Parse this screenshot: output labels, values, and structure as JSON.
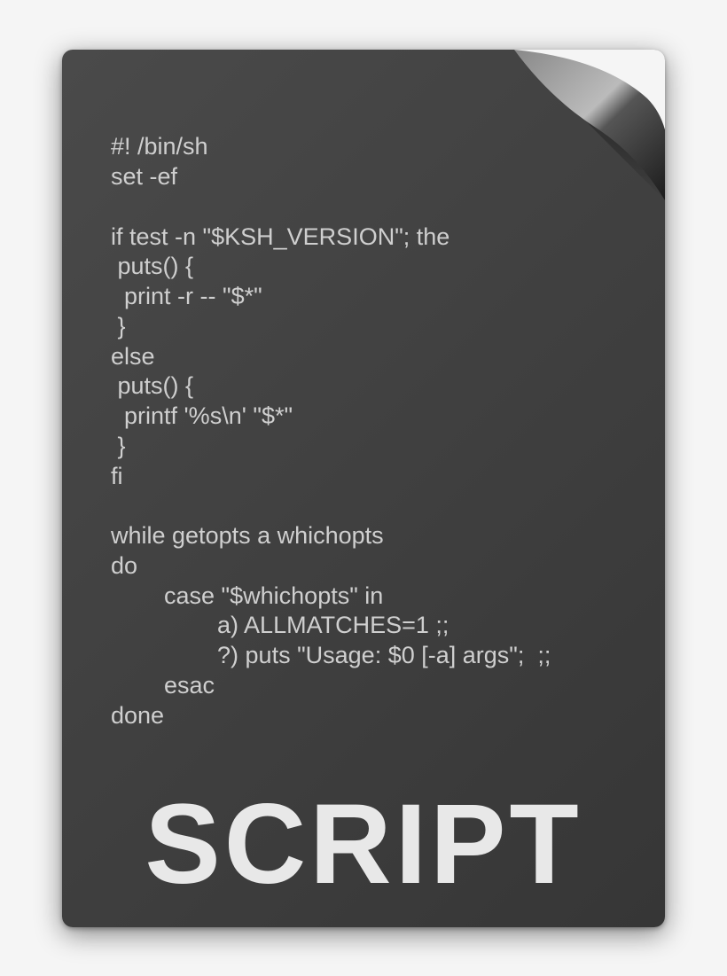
{
  "code": {
    "lines": [
      "#! /bin/sh",
      "set -ef",
      "",
      "if test -n \"$KSH_VERSION\"; the",
      " puts() {",
      "  print -r -- \"$*\"",
      " }",
      "else",
      " puts() {",
      "  printf '%s\\n' \"$*\"",
      " }",
      "fi",
      "",
      "while getopts a whichopts",
      "do",
      "        case \"$whichopts\" in",
      "                a) ALLMATCHES=1 ;;",
      "                ?) puts \"Usage: $0 [-a] args\";  ;;",
      "        esac",
      "done"
    ]
  },
  "label": "SCRIPT"
}
